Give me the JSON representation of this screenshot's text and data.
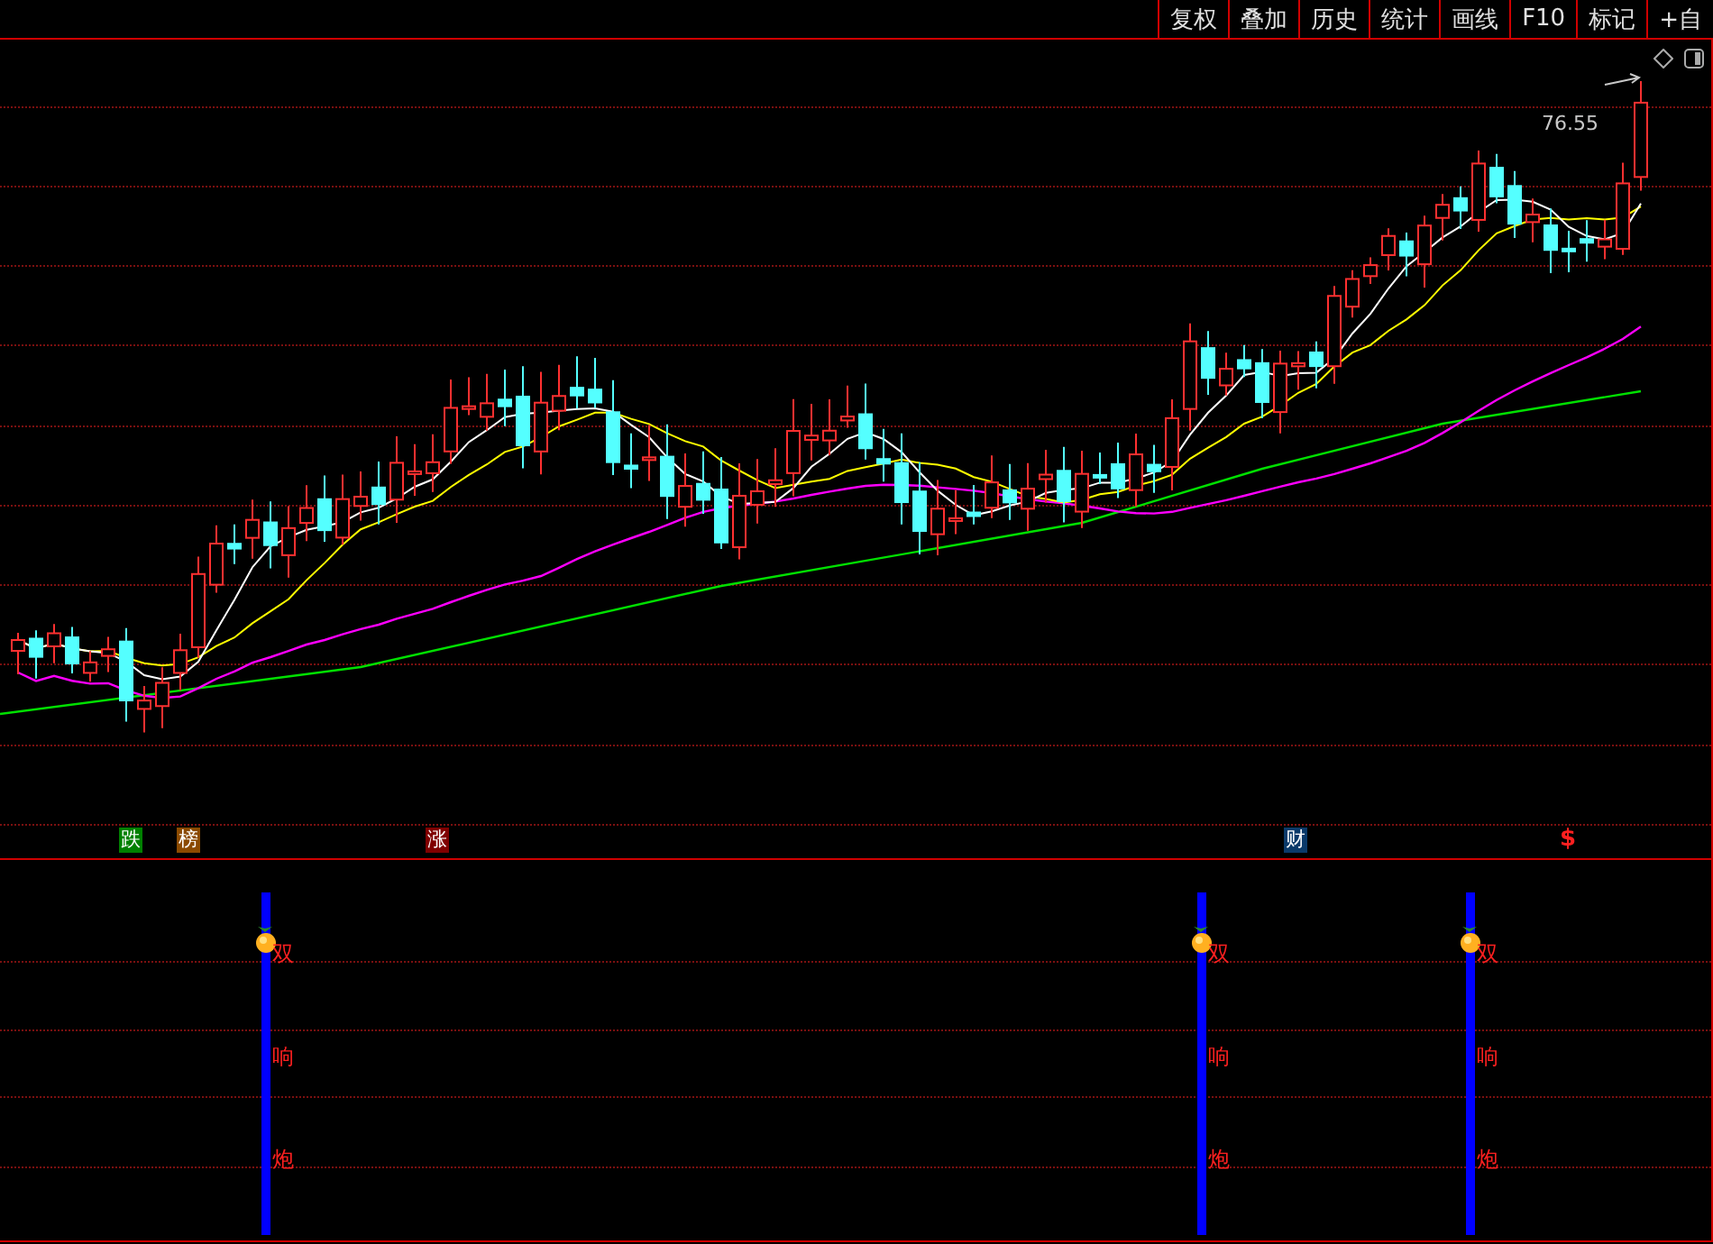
{
  "toolbar": {
    "buttons": [
      "复权",
      "叠加",
      "历史",
      "统计",
      "画线",
      "F10",
      "标记",
      "+自"
    ]
  },
  "main_chart": {
    "price_label": "76.55",
    "markers": [
      {
        "kind": "tag",
        "text": "跌",
        "color": "#008000"
      },
      {
        "kind": "tag",
        "text": "榜",
        "color": "#8b4a00"
      },
      {
        "kind": "tag",
        "text": "涨",
        "color": "#800000"
      },
      {
        "kind": "tag",
        "text": "财",
        "color": "#0a3a6a"
      },
      {
        "kind": "symbol",
        "text": "$",
        "color": "#ff2020"
      }
    ]
  },
  "signal_panel": {
    "signals": [
      {
        "chars": [
          "双",
          "响",
          "炮"
        ]
      },
      {
        "chars": [
          "双",
          "响",
          "炮"
        ]
      },
      {
        "chars": [
          "双",
          "响",
          "炮"
        ]
      }
    ]
  }
}
